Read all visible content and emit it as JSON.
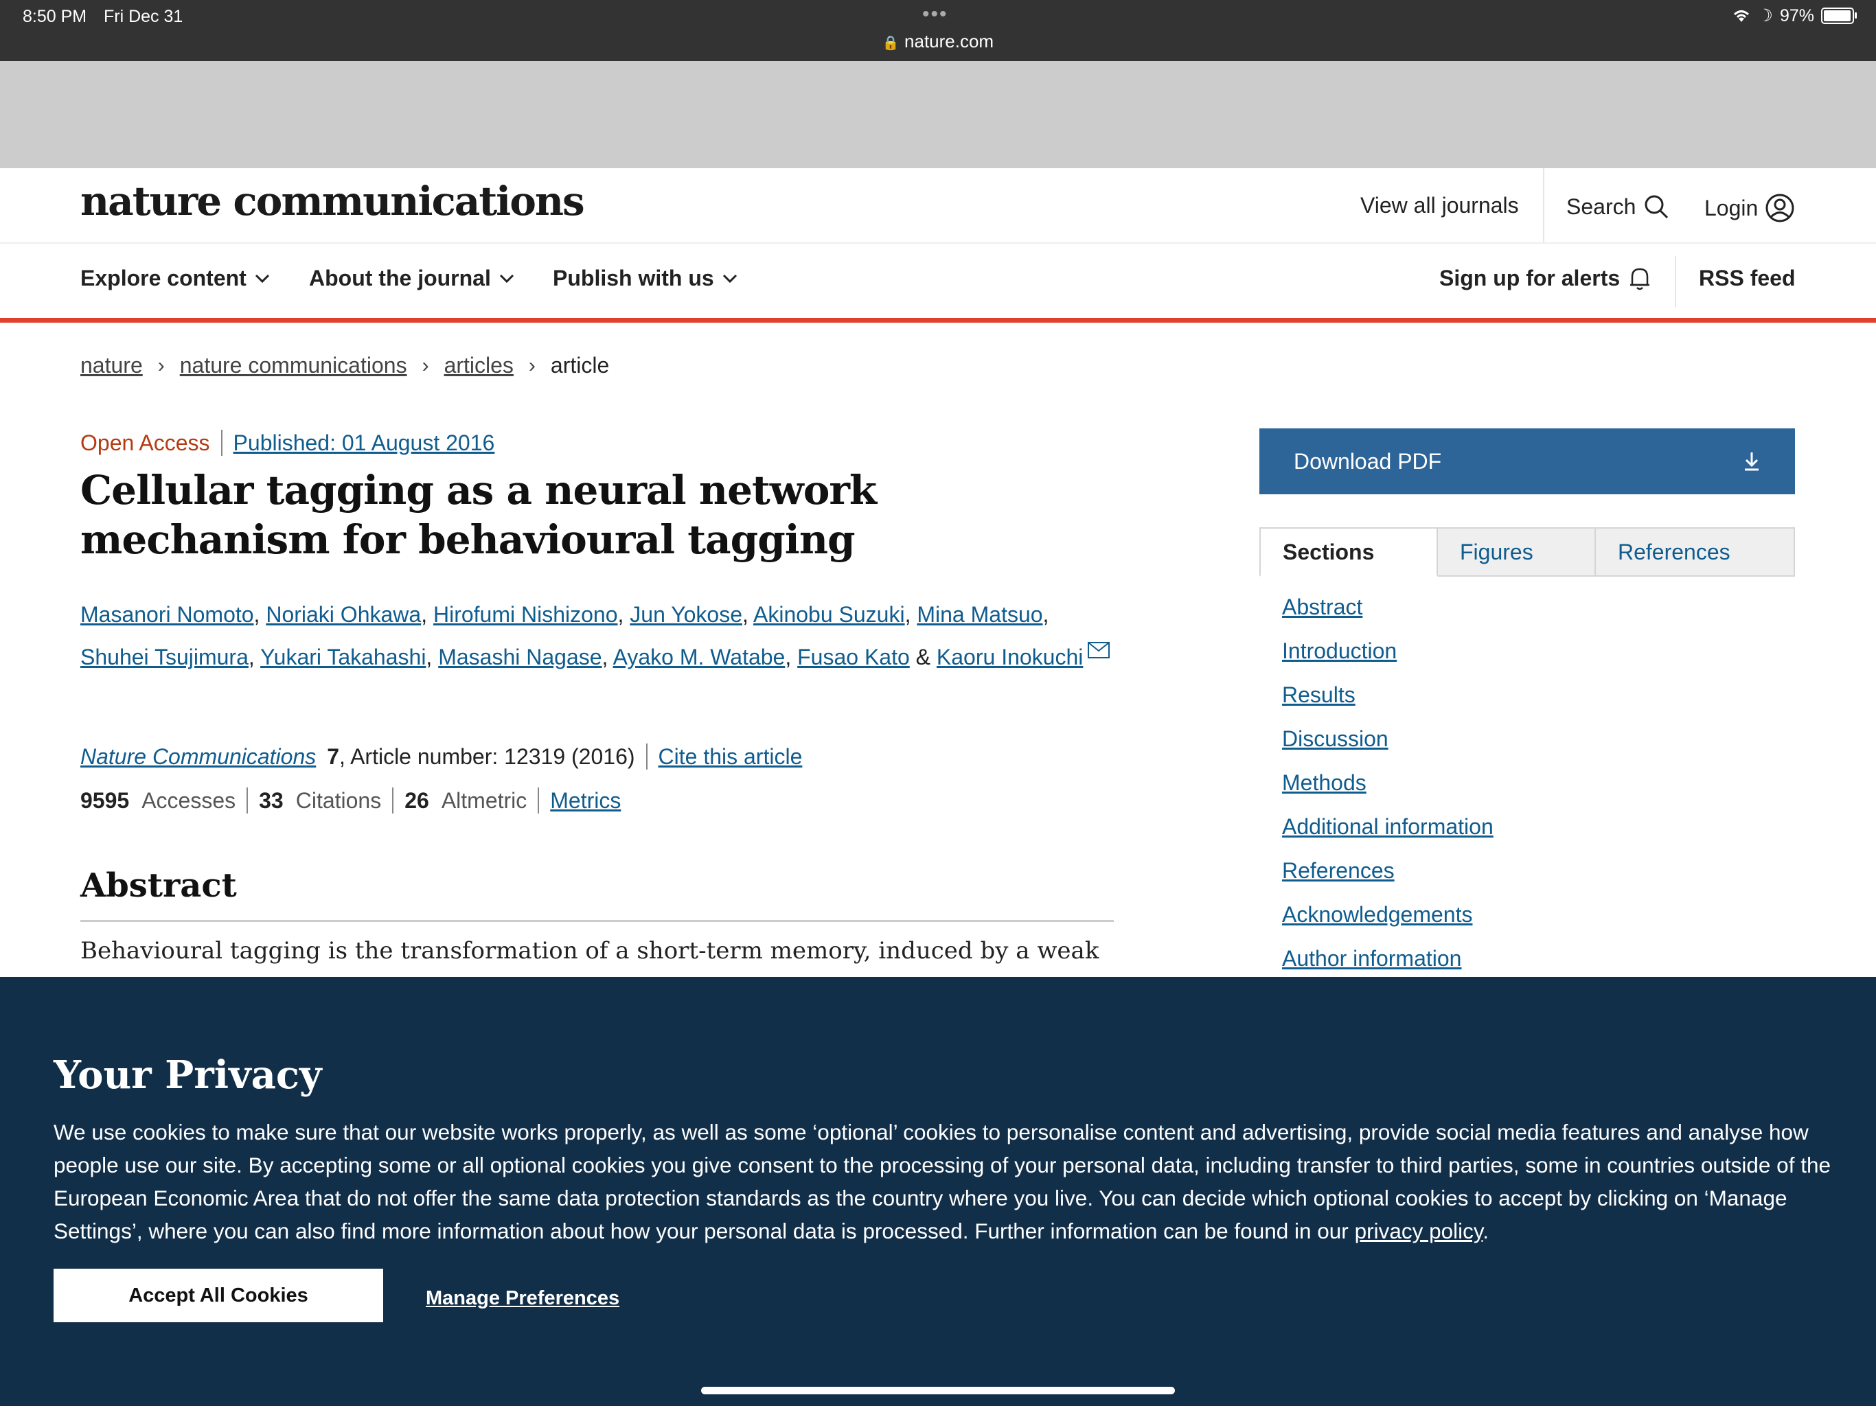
{
  "status_bar": {
    "time": "8:50 PM",
    "date": "Fri Dec 31",
    "url": "nature.com",
    "battery": "97%",
    "battery_level": 0.97
  },
  "header": {
    "logo": "nature communications",
    "view_all_journals": "View all journals",
    "search": "Search",
    "login": "Login"
  },
  "nav": {
    "items": [
      "Explore content",
      "About the journal",
      "Publish with us"
    ],
    "alerts": "Sign up for alerts",
    "rss": "RSS feed"
  },
  "breadcrumb": [
    "nature",
    "nature communications",
    "articles",
    "article"
  ],
  "article": {
    "open_access": "Open Access",
    "published": "Published: 01 August 2016",
    "title": "Cellular tagging as a neural network mechanism for behavioural tagging",
    "authors": [
      "Masanori Nomoto",
      "Noriaki Ohkawa",
      "Hirofumi Nishizono",
      "Jun Yokose",
      "Akinobu Suzuki",
      "Mina Matsuo",
      "Shuhei Tsujimura",
      "Yukari Takahashi",
      "Masashi Nagase",
      "Ayako M. Watabe",
      "Fusao Kato",
      "Kaoru Inokuchi"
    ],
    "journal": "Nature Communications",
    "volume": "7",
    "article_number": ", Article number: 12319 (2016)",
    "cite": "Cite this article",
    "accesses_num": "9595",
    "accesses_lbl": "Accesses",
    "citations_num": "33",
    "citations_lbl": "Citations",
    "altmetric_num": "26",
    "altmetric_lbl": "Altmetric",
    "metrics": "Metrics",
    "abstract_heading": "Abstract",
    "abstract_start": "Behavioural tagging is the transformation of a short-term memory, induced by a weak"
  },
  "sidebar": {
    "download": "Download PDF",
    "tabs": [
      "Sections",
      "Figures",
      "References"
    ],
    "sections": [
      "Abstract",
      "Introduction",
      "Results",
      "Discussion",
      "Methods",
      "Additional information",
      "References",
      "Acknowledgements",
      "Author information"
    ]
  },
  "privacy": {
    "heading": "Your Privacy",
    "text": "We use cookies to make sure that our website works properly, as well as some ‘optional’ cookies to personalise content and advertising, provide social media features and analyse how people use our site. By accepting some or all optional cookies you give consent to the processing of your personal data, including transfer to third parties, some in countries outside of the European Economic Area that do not offer the same data protection standards as the country where you live. You can decide which optional cookies to accept by clicking on ‘Manage Settings’, where you can also find more information about how your personal data is processed. Further information can be found in our ",
    "policy_link": "privacy policy",
    "accept": "Accept All Cookies",
    "manage": "Manage Preferences"
  }
}
